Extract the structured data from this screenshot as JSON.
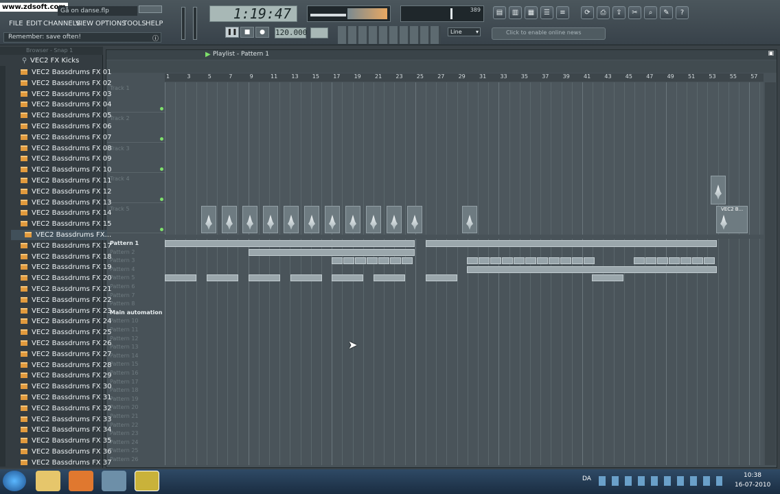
{
  "watermark": "www.zdsoft.com",
  "window_title": "Gå on danse.flp",
  "menu": [
    "FILE",
    "EDIT",
    "CHANNELS",
    "VIEW",
    "OPTIONS",
    "TOOLS",
    "HELP"
  ],
  "hint": "Remember: save often!",
  "time_display": "1:19:47",
  "tempo_display": "120.000",
  "cpu_value": "389",
  "snap_select": "Line",
  "news_text": "Click to enable online news",
  "browser": {
    "title": "Browser - Snap 1",
    "folder": "VEC2 FX Kicks",
    "items": [
      "VEC2 Bassdrums FX 01",
      "VEC2 Bassdrums FX 02",
      "VEC2 Bassdrums FX 03",
      "VEC2 Bassdrums FX 04",
      "VEC2 Bassdrums FX 05",
      "VEC2 Bassdrums FX 06",
      "VEC2 Bassdrums FX 07",
      "VEC2 Bassdrums FX 08",
      "VEC2 Bassdrums FX 09",
      "VEC2 Bassdrums FX 10",
      "VEC2 Bassdrums FX 11",
      "VEC2 Bassdrums FX 12",
      "VEC2 Bassdrums FX 13",
      "VEC2 Bassdrums FX 14",
      "VEC2 Bassdrums FX 15",
      "VEC2 Bassdrums FX...",
      "VEC2 Bassdrums FX 17",
      "VEC2 Bassdrums FX 18",
      "VEC2 Bassdrums FX 19",
      "VEC2 Bassdrums FX 20",
      "VEC2 Bassdrums FX 21",
      "VEC2 Bassdrums FX 22",
      "VEC2 Bassdrums FX 23",
      "VEC2 Bassdrums FX 24",
      "VEC2 Bassdrums FX 25",
      "VEC2 Bassdrums FX 26",
      "VEC2 Bassdrums FX 27",
      "VEC2 Bassdrums FX 28",
      "VEC2 Bassdrums FX 29",
      "VEC2 Bassdrums FX 30",
      "VEC2 Bassdrums FX 31",
      "VEC2 Bassdrums FX 32",
      "VEC2 Bassdrums FX 33",
      "VEC2 Bassdrums FX 34",
      "VEC2 Bassdrums FX 35",
      "VEC2 Bassdrums FX 36",
      "VEC2 Bassdrums FX 37"
    ]
  },
  "playlist": {
    "title": "Playlist - Pattern 1",
    "ruler": [
      "1",
      "3",
      "5",
      "7",
      "9",
      "11",
      "13",
      "15",
      "17",
      "19",
      "21",
      "23",
      "25",
      "27",
      "29",
      "31",
      "33",
      "35",
      "37",
      "39",
      "41",
      "43",
      "45",
      "47",
      "49",
      "51",
      "53",
      "55",
      "57"
    ],
    "tracks": [
      "Track 1",
      "Track 2",
      "Track 3",
      "Track 4",
      "Track 5"
    ],
    "clip_label": "VEC2 B...",
    "patterns": [
      "Pattern 1",
      "Pattern 2",
      "Pattern 3",
      "Pattern 4",
      "Pattern 5",
      "Pattern 6",
      "Pattern 7",
      "Pattern 8",
      "Main automation",
      "Pattern 10",
      "Pattern 11",
      "Pattern 12",
      "Pattern 13",
      "Pattern 14",
      "Pattern 15",
      "Pattern 16",
      "Pattern 17",
      "Pattern 18",
      "Pattern 19",
      "Pattern 20",
      "Pattern 21",
      "Pattern 22",
      "Pattern 23",
      "Pattern 24",
      "Pattern 25",
      "Pattern 26"
    ]
  },
  "taskbar": {
    "lang": "DA",
    "time": "10:38",
    "date": "16-07-2010"
  }
}
